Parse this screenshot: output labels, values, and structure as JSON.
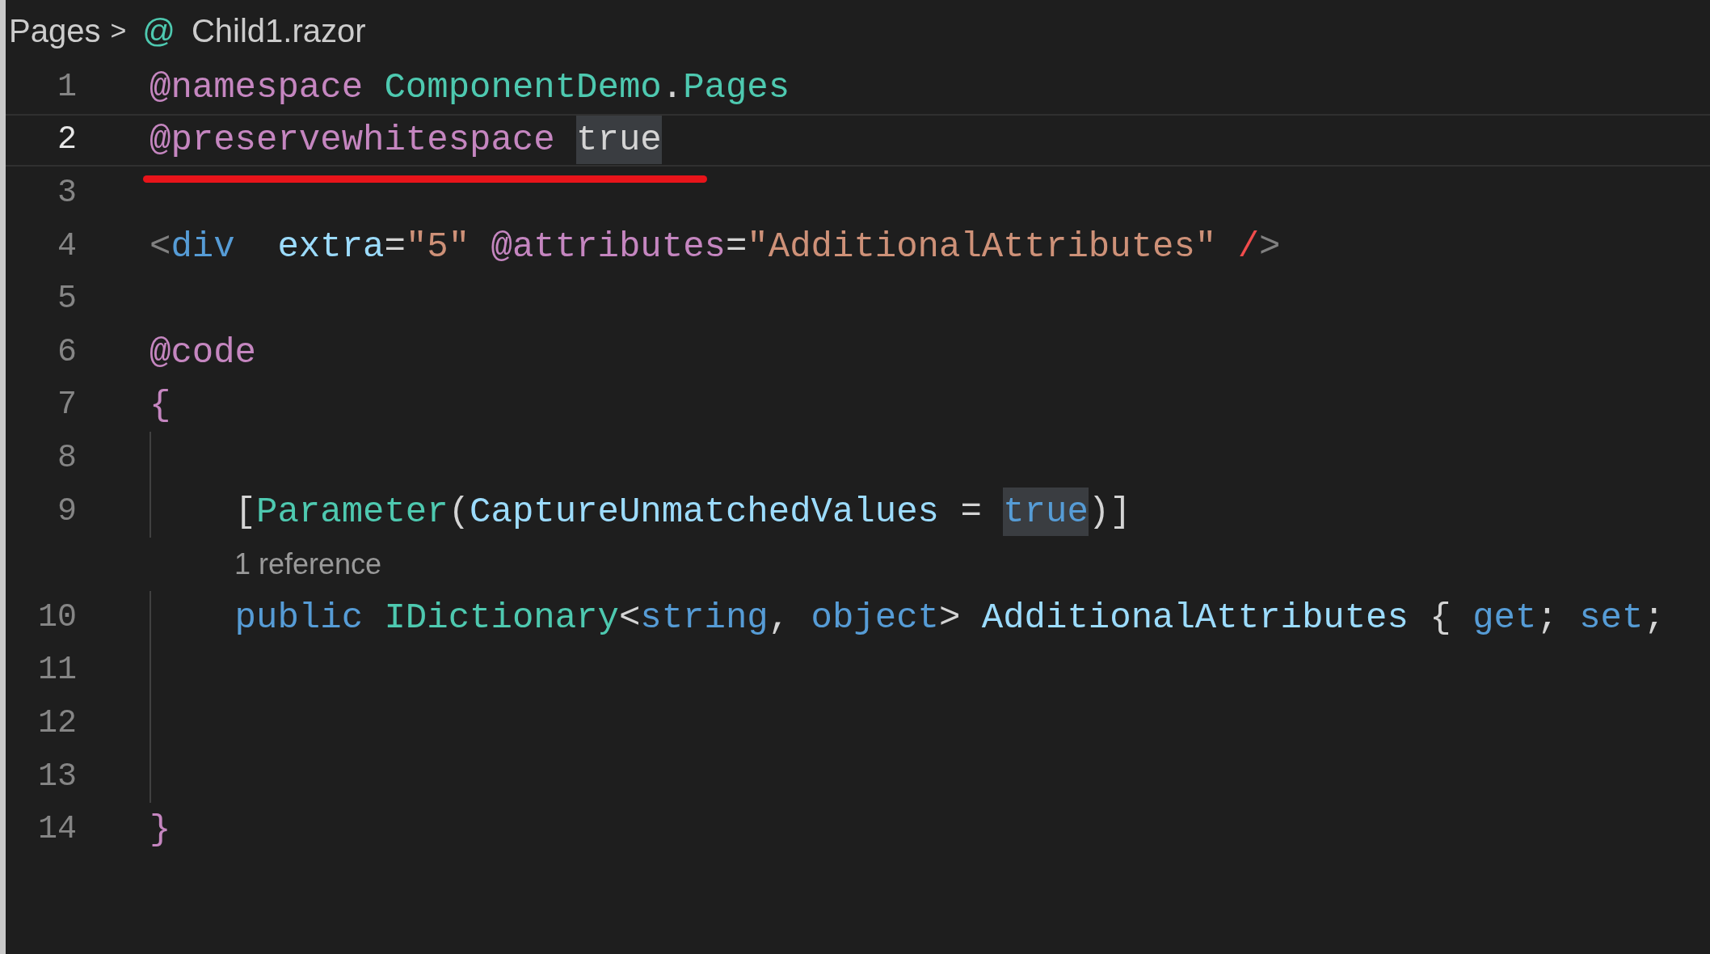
{
  "breadcrumb": {
    "folder": "Pages",
    "separator": ">",
    "file_icon": "@",
    "file": "Child1.razor"
  },
  "lines": [
    {
      "number": "1",
      "current": false,
      "tokens": [
        {
          "text": "@namespace",
          "kind": "directive"
        },
        {
          "text": " ComponentDemo",
          "kind": "type"
        },
        {
          "text": ".",
          "kind": "plain"
        },
        {
          "text": "Pages",
          "kind": "type"
        }
      ]
    },
    {
      "number": "2",
      "current": true,
      "underlined": true,
      "tokens": [
        {
          "text": "@preservewhitespace ",
          "kind": "directive"
        },
        {
          "text": "true",
          "kind": "plain",
          "highlighted": true
        }
      ]
    },
    {
      "number": "3",
      "current": false
    },
    {
      "number": "4",
      "current": false,
      "tokens": [
        {
          "text": "<",
          "kind": "punct"
        },
        {
          "text": "div",
          "kind": "keyword"
        },
        {
          "text": "  extra",
          "kind": "attr"
        },
        {
          "text": "=",
          "kind": "plain"
        },
        {
          "text": "\"5\" ",
          "kind": "string"
        },
        {
          "text": "@attributes",
          "kind": "directive"
        },
        {
          "text": "=",
          "kind": "plain"
        },
        {
          "text": "\"AdditionalAttributes\" ",
          "kind": "string"
        },
        {
          "text": "/",
          "kind": "error"
        },
        {
          "text": ">",
          "kind": "punct"
        }
      ]
    },
    {
      "number": "5",
      "current": false
    },
    {
      "number": "6",
      "current": false,
      "tokens": [
        {
          "text": "@code",
          "kind": "directive"
        }
      ]
    },
    {
      "number": "7",
      "current": false,
      "tokens": [
        {
          "text": "{",
          "kind": "directive"
        }
      ]
    },
    {
      "number": "8",
      "current": false,
      "guide": true
    },
    {
      "number": "9",
      "current": false,
      "guide": true,
      "tokens": [
        {
          "text": "    [",
          "kind": "plain"
        },
        {
          "text": "Parameter",
          "kind": "type"
        },
        {
          "text": "(",
          "kind": "plain"
        },
        {
          "text": "CaptureUnmatchedValues",
          "kind": "attr"
        },
        {
          "text": " = ",
          "kind": "plain"
        },
        {
          "text": "true",
          "kind": "keyword",
          "highlighted": true
        },
        {
          "text": ")]",
          "kind": "plain"
        }
      ]
    },
    {
      "kind": "codelens",
      "text": "1 reference"
    },
    {
      "number": "10",
      "current": false,
      "guide": true,
      "tokens": [
        {
          "text": "    public",
          "kind": "keyword"
        },
        {
          "text": " IDictionary",
          "kind": "type"
        },
        {
          "text": "<",
          "kind": "plain"
        },
        {
          "text": "string",
          "kind": "keyword"
        },
        {
          "text": ", ",
          "kind": "plain"
        },
        {
          "text": "object",
          "kind": "keyword"
        },
        {
          "text": "> ",
          "kind": "plain"
        },
        {
          "text": "AdditionalAttributes",
          "kind": "attr"
        },
        {
          "text": " { ",
          "kind": "plain"
        },
        {
          "text": "get",
          "kind": "keyword"
        },
        {
          "text": "; ",
          "kind": "plain"
        },
        {
          "text": "set",
          "kind": "keyword"
        },
        {
          "text": "; ",
          "kind": "plain"
        }
      ]
    },
    {
      "number": "11",
      "current": false,
      "guide": true
    },
    {
      "number": "12",
      "current": false,
      "guide": true
    },
    {
      "number": "13",
      "current": false,
      "guide": true
    },
    {
      "number": "14",
      "current": false,
      "tokens": [
        {
          "text": "}",
          "kind": "directive"
        }
      ]
    }
  ]
}
